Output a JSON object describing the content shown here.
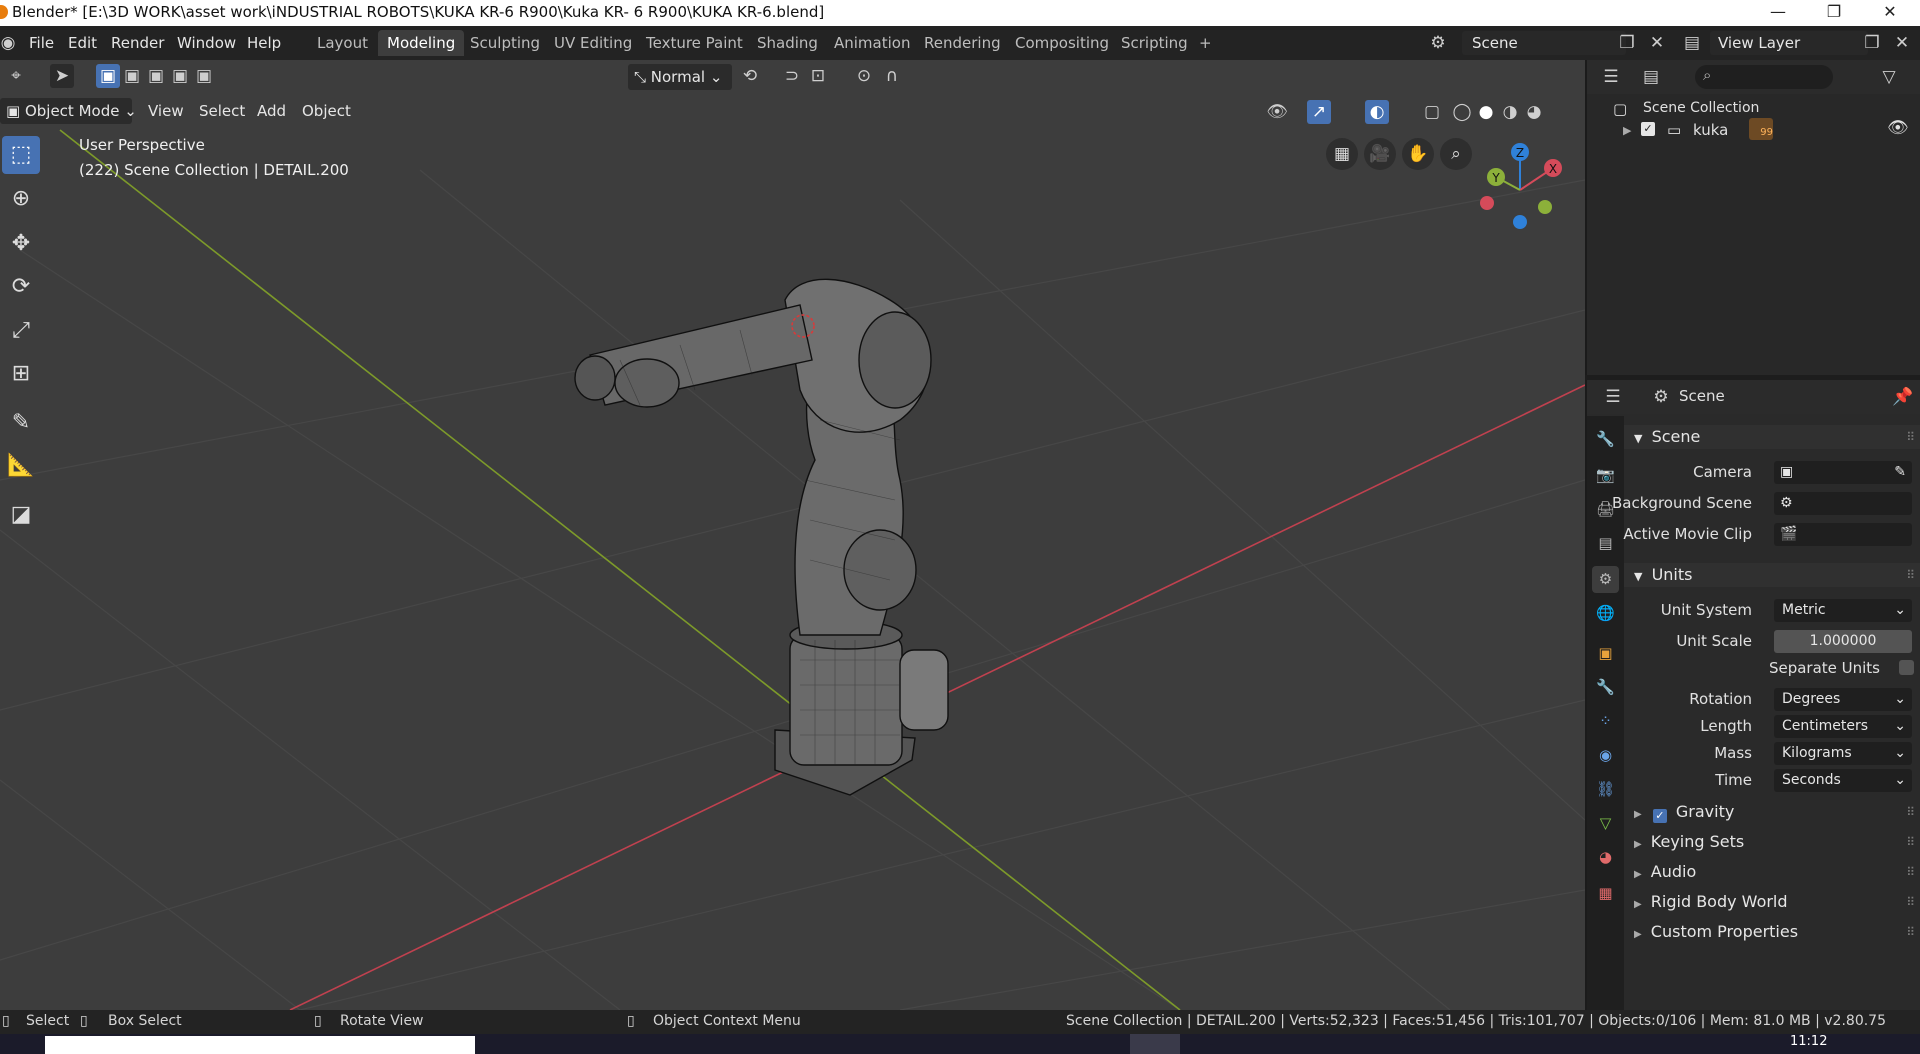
{
  "window": {
    "title": "Blender* [E:\\3D WORK\\asset work\\iNDUSTRIAL ROBOTS\\KUKA KR-6 R900\\Kuka KR- 6 R900\\KUKA KR-6.blend]",
    "minimize": "—",
    "restore": "❐",
    "close": "✕"
  },
  "menu": [
    "File",
    "Edit",
    "Render",
    "Window",
    "Help"
  ],
  "workspaces": [
    "Layout",
    "Modeling",
    "Sculpting",
    "UV Editing",
    "Texture Paint",
    "Shading",
    "Animation",
    "Rendering",
    "Compositing",
    "Scripting"
  ],
  "active_workspace": "Modeling",
  "add_workspace": "+",
  "scene_field": "Scene",
  "view_layer_field": "View Layer",
  "viewport": {
    "mode": "Object Mode",
    "menus": [
      "View",
      "Select",
      "Add",
      "Object"
    ],
    "transform_orientation": "Normal",
    "perspective_label": "User Perspective",
    "collection_label": "(222) Scene Collection | DETAIL.200",
    "gizmo": {
      "x": "X",
      "y": "Y",
      "z": "Z"
    }
  },
  "outliner": {
    "search_placeholder": "",
    "root": "Scene Collection",
    "items": [
      {
        "name": "kuka",
        "badge": "99"
      }
    ]
  },
  "properties": {
    "header": "Scene",
    "sections": {
      "scene": {
        "title": "Scene",
        "camera_label": "Camera",
        "background_label": "Background Scene",
        "clip_label": "Active Movie Clip"
      },
      "units": {
        "title": "Units",
        "unit_system_label": "Unit System",
        "unit_system": "Metric",
        "unit_scale_label": "Unit Scale",
        "unit_scale": "1.000000",
        "separate_units_label": "Separate Units",
        "rotation_label": "Rotation",
        "rotation": "Degrees",
        "length_label": "Length",
        "length": "Centimeters",
        "mass_label": "Mass",
        "mass": "Kilograms",
        "time_label": "Time",
        "time": "Seconds"
      },
      "collapsed": [
        "Gravity",
        "Keying Sets",
        "Audio",
        "Rigid Body World",
        "Custom Properties"
      ]
    }
  },
  "status": {
    "select": "Select",
    "box_select": "Box Select",
    "rotate_view": "Rotate View",
    "context_menu": "Object Context Menu",
    "stats": "Scene Collection | DETAIL.200 | Verts:52,323 | Faces:51,456 | Tris:101,707 | Objects:0/106 | Mem: 81.0 MB | v2.80.75"
  },
  "taskbar": {
    "clock": "11:12"
  },
  "colors": {
    "accent": "#4772b3",
    "x_axis": "#d54b5a",
    "y_axis": "#8cb03a",
    "z_axis": "#2f81d9",
    "viewport_bg": "#3d3d3d"
  }
}
